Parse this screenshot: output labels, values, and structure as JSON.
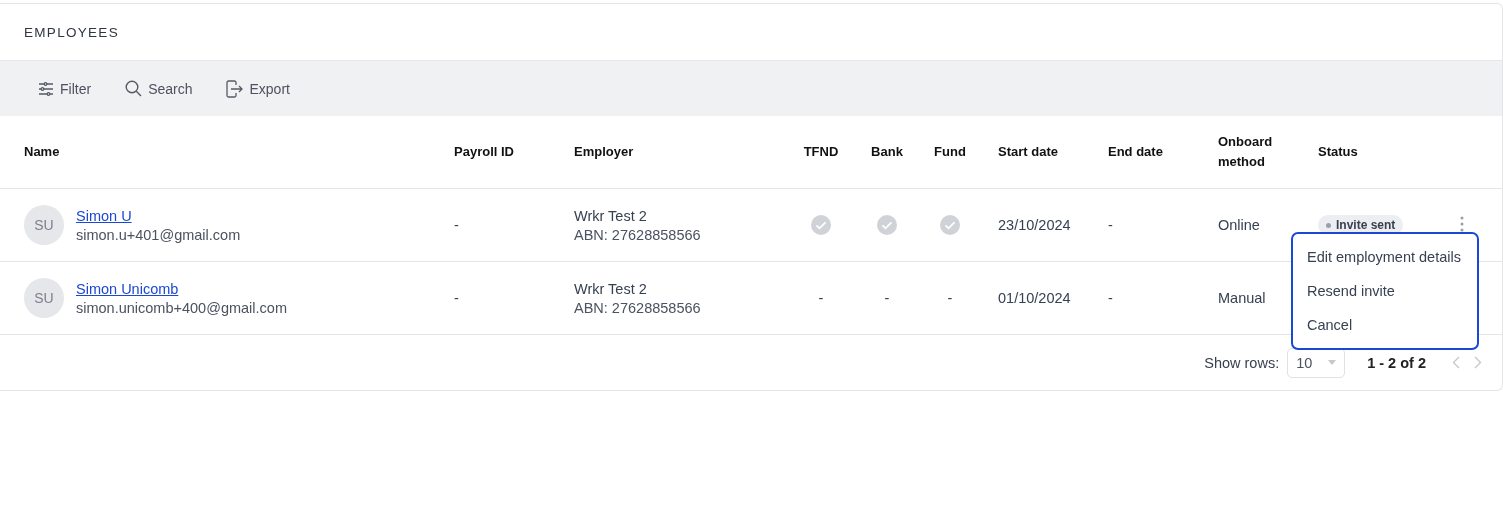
{
  "title": "EMPLOYEES",
  "toolbar": [
    {
      "kind": "filter",
      "label": "Filter"
    },
    {
      "kind": "search",
      "label": "Search"
    },
    {
      "kind": "export",
      "label": "Export"
    }
  ],
  "table": {
    "columns": [
      "Name",
      "Payroll ID",
      "Employer",
      "TFND",
      "Bank",
      "Fund",
      "Start date",
      "End date",
      "Onboard method",
      "Status"
    ],
    "rows": [
      {
        "initials": "SU",
        "name": "Simon U",
        "email": "simon.u+401@gmail.com",
        "payroll_id": "-",
        "employer": "Wrkr Test 2",
        "abn": "ABN: 27628858566",
        "tfnd": {
          "done": true
        },
        "bank": {
          "done": true
        },
        "fund": {
          "done": true
        },
        "start_date": "23/10/2024",
        "end_date": "-",
        "onboard_method": "Online",
        "status": "Invite sent"
      },
      {
        "initials": "SU",
        "name": "Simon Unicomb",
        "email": "simon.unicomb+400@gmail.com",
        "payroll_id": "-",
        "employer": "Wrkr Test 2",
        "abn": "ABN: 27628858566",
        "tfnd": {
          "done": false,
          "text": "-"
        },
        "bank": {
          "done": false,
          "text": "-"
        },
        "fund": {
          "done": false,
          "text": "-"
        },
        "start_date": "01/10/2024",
        "end_date": "-",
        "onboard_method": "Manual"
      }
    ]
  },
  "row_menu": {
    "items": [
      "Edit employment details",
      "Resend invite",
      "Cancel"
    ]
  },
  "footer": {
    "show_rows_label": "Show rows:",
    "rows_per_page": "10",
    "range": "1 - 2 of 2"
  }
}
